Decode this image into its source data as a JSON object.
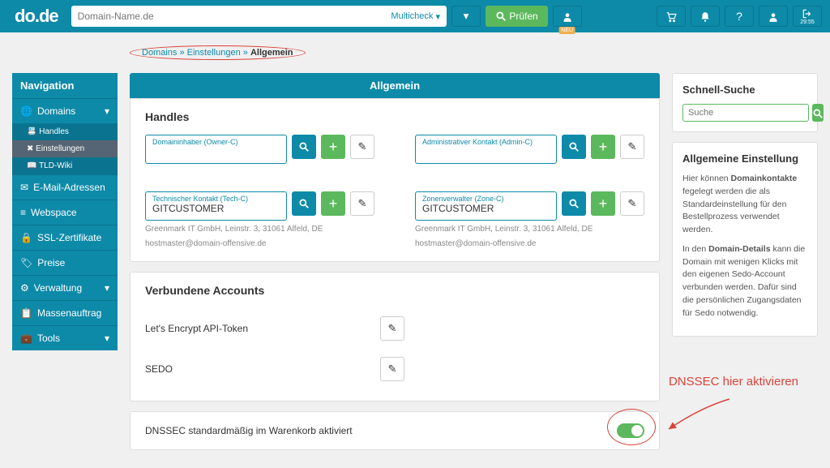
{
  "header": {
    "logo": "do.de",
    "search_placeholder": "Domain-Name.de",
    "multicheck": "Multicheck",
    "check": "Prüfen",
    "neu": "NEU"
  },
  "breadcrumb": {
    "p1": "Domains",
    "p2": "Einstellungen",
    "p3": "Allgemein"
  },
  "nav": {
    "title": "Navigation",
    "domains": "Domains",
    "handles": "Handles",
    "einstellungen": "Einstellungen",
    "tldwiki": "TLD-Wiki",
    "email": "E-Mail-Adressen",
    "webspace": "Webspace",
    "ssl": "SSL-Zertifikate",
    "preise": "Preise",
    "verwaltung": "Verwaltung",
    "massen": "Massenauftrag",
    "tools": "Tools"
  },
  "main_title": "Allgemein",
  "handles": {
    "heading": "Handles",
    "owner": {
      "label": "Domaininhaber (Owner-C)",
      "value": "",
      "line1": "",
      "line2": ""
    },
    "admin": {
      "label": "Administrativer Kontakt (Admin-C)",
      "value": "",
      "line1": "",
      "line2": ""
    },
    "tech": {
      "label": "Technischer Kontakt (Tech-C)",
      "value": "GITCUSTOMER",
      "line1": "Greenmark IT GmbH, Leinstr. 3, 31061 Alfeld, DE",
      "line2": "hostmaster@domain-offensive.de"
    },
    "zone": {
      "label": "Zonenverwalter (Zone-C)",
      "value": "GITCUSTOMER",
      "line1": "Greenmark IT GmbH, Leinstr. 3, 31061 Alfeld, DE",
      "line2": "hostmaster@domain-offensive.de"
    }
  },
  "accounts": {
    "heading": "Verbundene Accounts",
    "le": "Let's Encrypt API-Token",
    "sedo": "SEDO"
  },
  "dnssec": {
    "label": "DNSSEC standardmäßig im Warenkorb aktiviert"
  },
  "quick": {
    "heading": "Schnell-Suche",
    "placeholder": "Suche"
  },
  "info": {
    "heading": "Allgemeine Einstellung",
    "p1a": "Hier können ",
    "p1b": "Domainkontakte",
    "p1c": " fegelegt werden die als Standardeinstellung für den Bestellprozess verwendet werden.",
    "p2a": "In den ",
    "p2b": "Domain-Details",
    "p2c": " kann die Domain mit wenigen Klicks mit den eigenen Sedo-Account verbunden werden. Dafür sind die persönlichen Zugangsdaten für Sedo notwendig."
  },
  "annotation": "DNSSEC hier aktivieren"
}
